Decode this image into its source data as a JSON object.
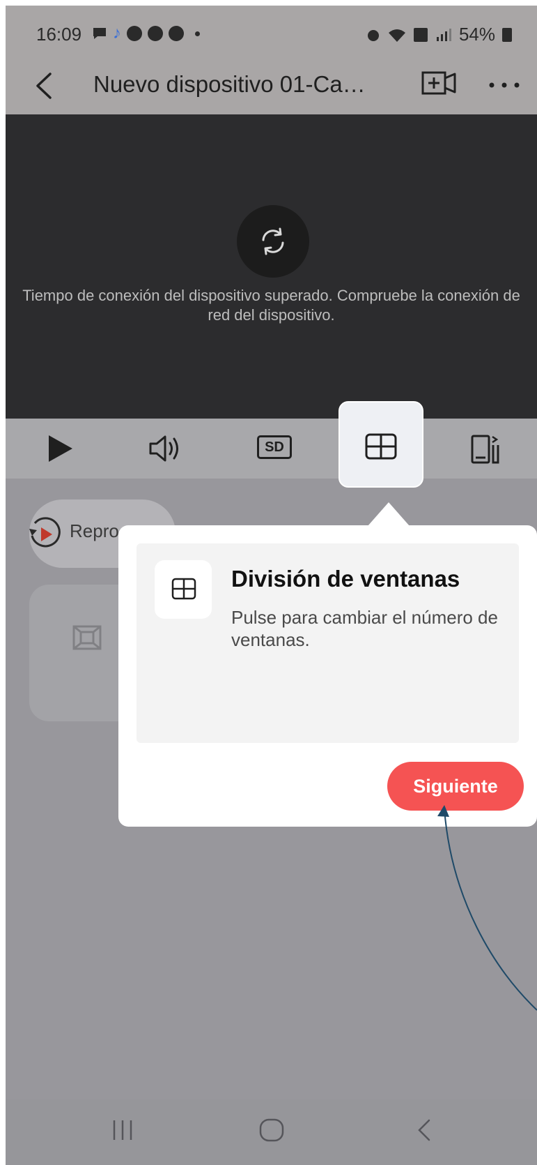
{
  "status_bar": {
    "time": "16:09",
    "battery": "54%"
  },
  "header": {
    "title": "Nuevo dispositivo 01-Ca…"
  },
  "video": {
    "message": "Tiempo de conexión del dispositivo superado. Compruebe la conexión de red del dispositivo."
  },
  "controls": {
    "sd_label": "SD"
  },
  "content": {
    "playback_chip": "Repro"
  },
  "tooltip": {
    "title": "División de ventanas",
    "description": "Pulse para cambiar el número de ventanas.",
    "next_label": "Siguiente"
  },
  "colors": {
    "accent": "#f55353",
    "annotation_arrow": "#1f4a68"
  }
}
